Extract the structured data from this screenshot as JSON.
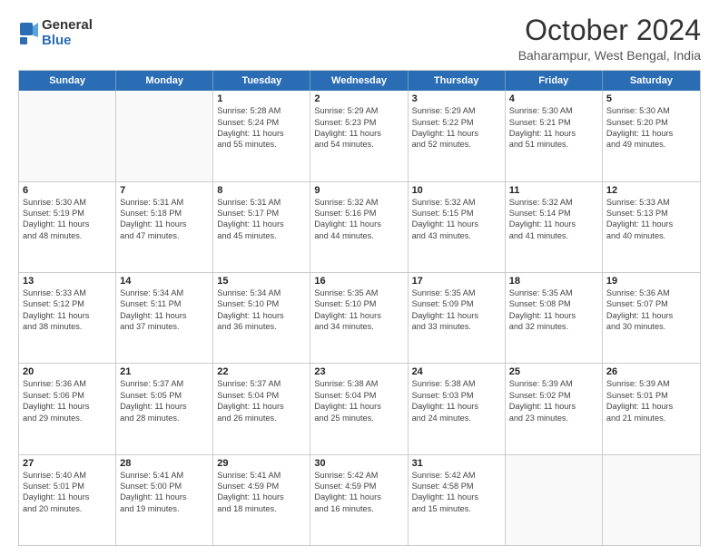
{
  "logo": {
    "general": "General",
    "blue": "Blue"
  },
  "header": {
    "month": "October 2024",
    "location": "Baharampur, West Bengal, India"
  },
  "days": [
    "Sunday",
    "Monday",
    "Tuesday",
    "Wednesday",
    "Thursday",
    "Friday",
    "Saturday"
  ],
  "weeks": [
    [
      {
        "day": "",
        "lines": []
      },
      {
        "day": "",
        "lines": []
      },
      {
        "day": "1",
        "lines": [
          "Sunrise: 5:28 AM",
          "Sunset: 5:24 PM",
          "Daylight: 11 hours",
          "and 55 minutes."
        ]
      },
      {
        "day": "2",
        "lines": [
          "Sunrise: 5:29 AM",
          "Sunset: 5:23 PM",
          "Daylight: 11 hours",
          "and 54 minutes."
        ]
      },
      {
        "day": "3",
        "lines": [
          "Sunrise: 5:29 AM",
          "Sunset: 5:22 PM",
          "Daylight: 11 hours",
          "and 52 minutes."
        ]
      },
      {
        "day": "4",
        "lines": [
          "Sunrise: 5:30 AM",
          "Sunset: 5:21 PM",
          "Daylight: 11 hours",
          "and 51 minutes."
        ]
      },
      {
        "day": "5",
        "lines": [
          "Sunrise: 5:30 AM",
          "Sunset: 5:20 PM",
          "Daylight: 11 hours",
          "and 49 minutes."
        ]
      }
    ],
    [
      {
        "day": "6",
        "lines": [
          "Sunrise: 5:30 AM",
          "Sunset: 5:19 PM",
          "Daylight: 11 hours",
          "and 48 minutes."
        ]
      },
      {
        "day": "7",
        "lines": [
          "Sunrise: 5:31 AM",
          "Sunset: 5:18 PM",
          "Daylight: 11 hours",
          "and 47 minutes."
        ]
      },
      {
        "day": "8",
        "lines": [
          "Sunrise: 5:31 AM",
          "Sunset: 5:17 PM",
          "Daylight: 11 hours",
          "and 45 minutes."
        ]
      },
      {
        "day": "9",
        "lines": [
          "Sunrise: 5:32 AM",
          "Sunset: 5:16 PM",
          "Daylight: 11 hours",
          "and 44 minutes."
        ]
      },
      {
        "day": "10",
        "lines": [
          "Sunrise: 5:32 AM",
          "Sunset: 5:15 PM",
          "Daylight: 11 hours",
          "and 43 minutes."
        ]
      },
      {
        "day": "11",
        "lines": [
          "Sunrise: 5:32 AM",
          "Sunset: 5:14 PM",
          "Daylight: 11 hours",
          "and 41 minutes."
        ]
      },
      {
        "day": "12",
        "lines": [
          "Sunrise: 5:33 AM",
          "Sunset: 5:13 PM",
          "Daylight: 11 hours",
          "and 40 minutes."
        ]
      }
    ],
    [
      {
        "day": "13",
        "lines": [
          "Sunrise: 5:33 AM",
          "Sunset: 5:12 PM",
          "Daylight: 11 hours",
          "and 38 minutes."
        ]
      },
      {
        "day": "14",
        "lines": [
          "Sunrise: 5:34 AM",
          "Sunset: 5:11 PM",
          "Daylight: 11 hours",
          "and 37 minutes."
        ]
      },
      {
        "day": "15",
        "lines": [
          "Sunrise: 5:34 AM",
          "Sunset: 5:10 PM",
          "Daylight: 11 hours",
          "and 36 minutes."
        ]
      },
      {
        "day": "16",
        "lines": [
          "Sunrise: 5:35 AM",
          "Sunset: 5:10 PM",
          "Daylight: 11 hours",
          "and 34 minutes."
        ]
      },
      {
        "day": "17",
        "lines": [
          "Sunrise: 5:35 AM",
          "Sunset: 5:09 PM",
          "Daylight: 11 hours",
          "and 33 minutes."
        ]
      },
      {
        "day": "18",
        "lines": [
          "Sunrise: 5:35 AM",
          "Sunset: 5:08 PM",
          "Daylight: 11 hours",
          "and 32 minutes."
        ]
      },
      {
        "day": "19",
        "lines": [
          "Sunrise: 5:36 AM",
          "Sunset: 5:07 PM",
          "Daylight: 11 hours",
          "and 30 minutes."
        ]
      }
    ],
    [
      {
        "day": "20",
        "lines": [
          "Sunrise: 5:36 AM",
          "Sunset: 5:06 PM",
          "Daylight: 11 hours",
          "and 29 minutes."
        ]
      },
      {
        "day": "21",
        "lines": [
          "Sunrise: 5:37 AM",
          "Sunset: 5:05 PM",
          "Daylight: 11 hours",
          "and 28 minutes."
        ]
      },
      {
        "day": "22",
        "lines": [
          "Sunrise: 5:37 AM",
          "Sunset: 5:04 PM",
          "Daylight: 11 hours",
          "and 26 minutes."
        ]
      },
      {
        "day": "23",
        "lines": [
          "Sunrise: 5:38 AM",
          "Sunset: 5:04 PM",
          "Daylight: 11 hours",
          "and 25 minutes."
        ]
      },
      {
        "day": "24",
        "lines": [
          "Sunrise: 5:38 AM",
          "Sunset: 5:03 PM",
          "Daylight: 11 hours",
          "and 24 minutes."
        ]
      },
      {
        "day": "25",
        "lines": [
          "Sunrise: 5:39 AM",
          "Sunset: 5:02 PM",
          "Daylight: 11 hours",
          "and 23 minutes."
        ]
      },
      {
        "day": "26",
        "lines": [
          "Sunrise: 5:39 AM",
          "Sunset: 5:01 PM",
          "Daylight: 11 hours",
          "and 21 minutes."
        ]
      }
    ],
    [
      {
        "day": "27",
        "lines": [
          "Sunrise: 5:40 AM",
          "Sunset: 5:01 PM",
          "Daylight: 11 hours",
          "and 20 minutes."
        ]
      },
      {
        "day": "28",
        "lines": [
          "Sunrise: 5:41 AM",
          "Sunset: 5:00 PM",
          "Daylight: 11 hours",
          "and 19 minutes."
        ]
      },
      {
        "day": "29",
        "lines": [
          "Sunrise: 5:41 AM",
          "Sunset: 4:59 PM",
          "Daylight: 11 hours",
          "and 18 minutes."
        ]
      },
      {
        "day": "30",
        "lines": [
          "Sunrise: 5:42 AM",
          "Sunset: 4:59 PM",
          "Daylight: 11 hours",
          "and 16 minutes."
        ]
      },
      {
        "day": "31",
        "lines": [
          "Sunrise: 5:42 AM",
          "Sunset: 4:58 PM",
          "Daylight: 11 hours",
          "and 15 minutes."
        ]
      },
      {
        "day": "",
        "lines": []
      },
      {
        "day": "",
        "lines": []
      }
    ]
  ]
}
